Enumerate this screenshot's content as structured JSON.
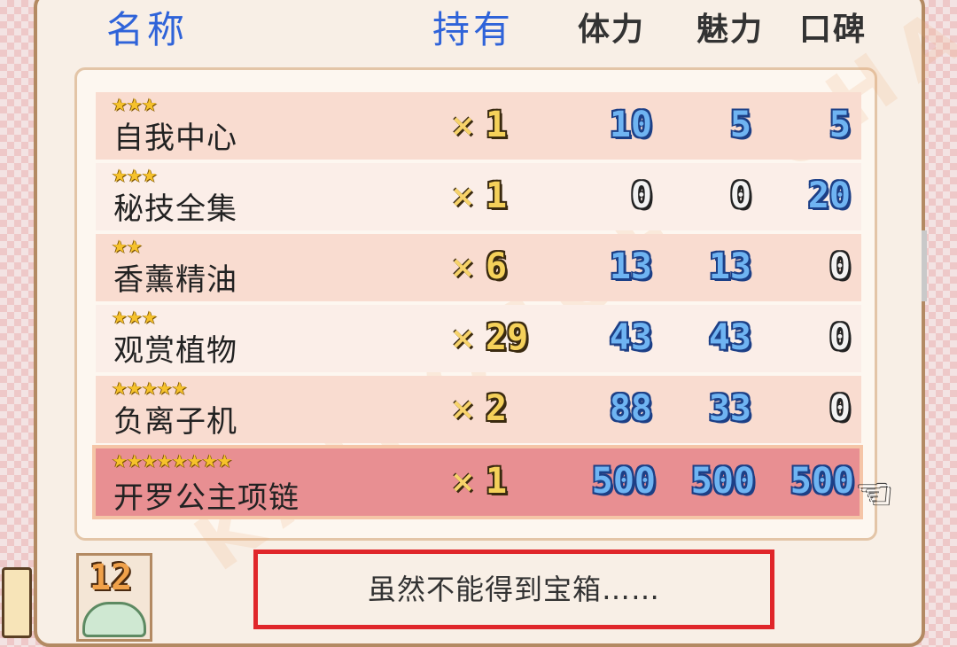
{
  "header": {
    "name_label": "名称",
    "owned_label": "持有",
    "stamina_label": "体力",
    "charm_label": "魅力",
    "reputation_label": "口碑"
  },
  "items": [
    {
      "stars": "★★★",
      "name": "自我中心",
      "x": "×",
      "qty": "1",
      "stamina": "10",
      "charm": "5",
      "reputation": "5"
    },
    {
      "stars": "★★★",
      "name": "秘技全集",
      "x": "×",
      "qty": "1",
      "stamina": "0",
      "charm": "0",
      "reputation": "20"
    },
    {
      "stars": "★★",
      "name": "香薰精油",
      "x": "×",
      "qty": "6",
      "stamina": "13",
      "charm": "13",
      "reputation": "0"
    },
    {
      "stars": "★★★",
      "name": "观赏植物",
      "x": "×",
      "qty": "29",
      "stamina": "43",
      "charm": "43",
      "reputation": "0"
    },
    {
      "stars": "★★★★★",
      "name": "负离子机",
      "x": "×",
      "qty": "2",
      "stamina": "88",
      "charm": "33",
      "reputation": "0"
    },
    {
      "stars": "★★★★★★★★",
      "name": "开罗公主项链",
      "x": "×",
      "qty": "1",
      "stamina": "500",
      "charm": "500",
      "reputation": "500"
    }
  ],
  "selected_index": 5,
  "calendar": {
    "number": "12"
  },
  "message": {
    "text": "虽然不能得到宝箱……"
  },
  "watermark": {
    "text": "KAIROSOFT CHANG"
  },
  "icons": {
    "cursor": "pointing-hand-icon"
  },
  "colors": {
    "header_blue": "#2f63d9",
    "highlight_red": "#e0262a",
    "stat_blue": "#6fb4f2"
  }
}
